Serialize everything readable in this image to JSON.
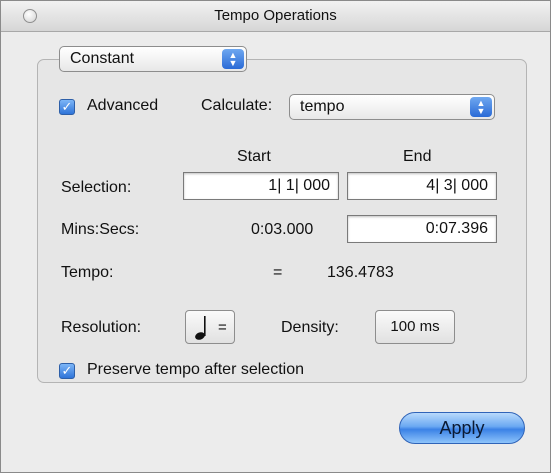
{
  "window": {
    "title": "Tempo Operations"
  },
  "mode_popup": {
    "value": "Constant"
  },
  "advanced": {
    "label": "Advanced",
    "checked": true
  },
  "calculate": {
    "label": "Calculate:",
    "value": "tempo"
  },
  "columns": {
    "start": "Start",
    "end": "End"
  },
  "selection": {
    "label": "Selection:",
    "start": "1| 1| 000",
    "end": "4| 3| 000"
  },
  "mins_secs": {
    "label": "Mins:Secs:",
    "start": "0:03.000",
    "end": "0:07.396"
  },
  "tempo": {
    "label": "Tempo:",
    "equals": "=",
    "value": "136.4783"
  },
  "resolution": {
    "label": "Resolution:",
    "note_icon": "quarter-note-icon",
    "equals": "="
  },
  "density": {
    "label": "Density:",
    "value": "100 ms"
  },
  "preserve": {
    "label": "Preserve tempo after selection",
    "checked": true
  },
  "apply_button": {
    "label": "Apply"
  },
  "colors": {
    "accent": "#3b82e6",
    "window_bg": "#ececec"
  }
}
